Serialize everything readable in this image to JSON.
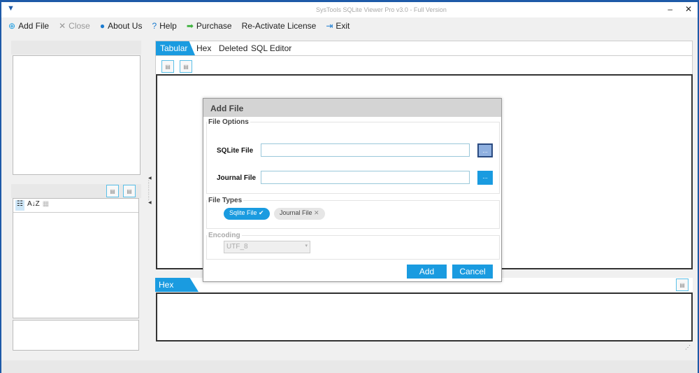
{
  "window": {
    "title": "SysTools SQLite Viewer Pro v3.0 - Full Version",
    "minimize": "–",
    "maximize": "☐",
    "close": "✕"
  },
  "menu": [
    {
      "label": "Add File",
      "icon": "add-file-icon",
      "glyph": "⊕",
      "color": "#1a9be0"
    },
    {
      "label": "Close",
      "icon": "close-icon",
      "glyph": "✕",
      "color": "#999"
    },
    {
      "label": "About Us",
      "icon": "user-icon",
      "glyph": "●",
      "color": "#1a7bd0"
    },
    {
      "label": "Help",
      "icon": "help-icon",
      "glyph": "?",
      "color": "#1a7bd0"
    },
    {
      "label": "Purchase",
      "icon": "arrow-right-icon",
      "glyph": "➡",
      "color": "#3ab03a"
    },
    {
      "label": "Re-Activate License",
      "icon": "",
      "glyph": "",
      "color": ""
    },
    {
      "label": "Exit",
      "icon": "exit-icon",
      "glyph": "⇥",
      "color": "#1a7bd0"
    }
  ],
  "tabs": [
    "Tabular",
    "Hex",
    "Deleted",
    "SQL Editor"
  ],
  "hex_tab": "Hex",
  "sort_icons": {
    "category": "☷",
    "alpha": "A↓Z"
  },
  "dialog": {
    "title": "Add File",
    "file_options": "File Options",
    "sqlite_label": "SQLite File",
    "sqlite_value": "",
    "journal_label": "Journal File",
    "journal_value": "",
    "browse": "...",
    "file_types": "File Types",
    "chip_sqlite": "Sqlite File",
    "chip_journal": "Journal File",
    "encoding": "Encoding",
    "encoding_value": "UTF_8",
    "add": "Add",
    "cancel": "Cancel"
  }
}
